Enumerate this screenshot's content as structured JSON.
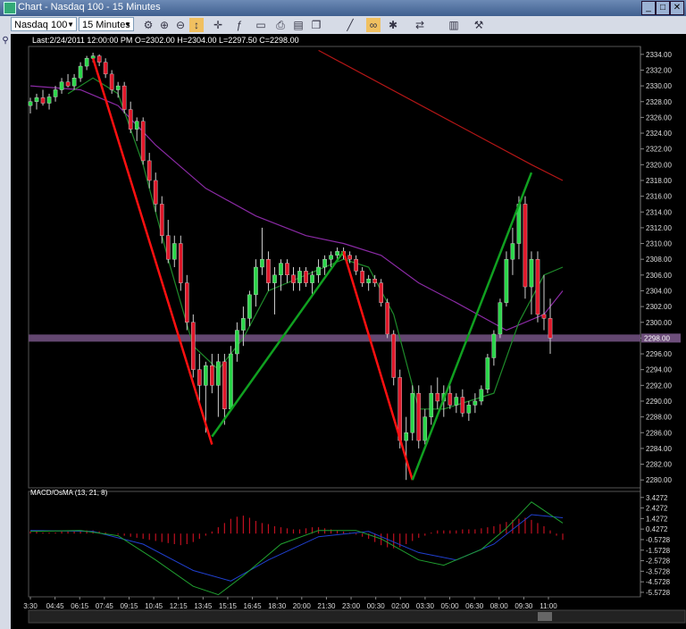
{
  "window": {
    "title": "Chart - Nasdaq 100 - 15 Minutes",
    "minimize": "_",
    "maximize": "□",
    "close": "✕"
  },
  "toolbar": {
    "symbol": "Nasdaq 100",
    "interval": "15 Minutes"
  },
  "icons": [
    "chart-settings-icon",
    "zoom-in-icon",
    "zoom-out-icon",
    "cursor-icon",
    "crosshair-icon",
    "indicator-icon",
    "template-icon",
    "print-icon",
    "save-icon",
    "copy-icon",
    "line-tool-icon",
    "link-icon",
    "object-icon",
    "compare-icon",
    "market-icon",
    "settings-icon"
  ],
  "colors": {
    "bg": "#000000",
    "up": "#2bd64a",
    "down": "#e0182a",
    "grid": "#303030",
    "ma_red": "#b41616",
    "ma_purple": "#8a2aa4",
    "ma_green": "#1e8a2a",
    "price_band": "#6e4f7c"
  },
  "chart_data": [
    {
      "type": "candlestick",
      "header": "Last:2/24/2011 12:00:00 PM O=2302.00 H=2304.00 L=2297.50 C=2298.00",
      "last_price_label": "2298.00",
      "ylim": [
        2279,
        2335
      ],
      "yticks": [
        "2334.00",
        "2332.00",
        "2330.00",
        "2328.00",
        "2326.00",
        "2324.00",
        "2322.00",
        "2320.00",
        "2318.00",
        "2316.00",
        "2314.00",
        "2312.00",
        "2310.00",
        "2308.00",
        "2306.00",
        "2304.00",
        "2302.00",
        "2300.00",
        "2298.00",
        "2296.00",
        "2294.00",
        "2292.00",
        "2290.00",
        "2288.00",
        "2286.00",
        "2284.00",
        "2282.00",
        "2280.00"
      ],
      "xticks": [
        "3:30",
        "04:45",
        "06:15",
        "07:45",
        "09:15",
        "10:45",
        "12:15",
        "13:45",
        "15:15",
        "16:45",
        "18:30",
        "20:00",
        "21:30",
        "23:00",
        "00:30",
        "02:00",
        "03:30",
        "05:00",
        "06:30",
        "08:00",
        "09:30",
        "11:00"
      ],
      "ohlc": [
        [
          2327.5,
          2328.5,
          2326.5,
          2328
        ],
        [
          2328,
          2329,
          2327,
          2328.5
        ],
        [
          2328.5,
          2329.5,
          2327.5,
          2327.8
        ],
        [
          2327.8,
          2329,
          2327,
          2328.6
        ],
        [
          2328.6,
          2330,
          2328,
          2329.5
        ],
        [
          2329.5,
          2331,
          2329,
          2330.5
        ],
        [
          2330.5,
          2331.5,
          2329.8,
          2330
        ],
        [
          2330,
          2331.5,
          2329.5,
          2331
        ],
        [
          2331,
          2333,
          2330.5,
          2332.5
        ],
        [
          2332.5,
          2333.8,
          2332,
          2333.5
        ],
        [
          2333.5,
          2334.2,
          2333,
          2333.8
        ],
        [
          2333.8,
          2334,
          2332.5,
          2333
        ],
        [
          2333,
          2333.5,
          2331,
          2331.5
        ],
        [
          2331.5,
          2332,
          2329,
          2329.5
        ],
        [
          2329.5,
          2330.5,
          2328.5,
          2330
        ],
        [
          2330,
          2330.5,
          2326.5,
          2327
        ],
        [
          2327,
          2328,
          2324,
          2324.5
        ],
        [
          2324.5,
          2326,
          2323,
          2325.5
        ],
        [
          2325.5,
          2326,
          2320,
          2320.5
        ],
        [
          2320.5,
          2321.5,
          2317,
          2318
        ],
        [
          2318,
          2319,
          2314,
          2315
        ],
        [
          2315,
          2316,
          2310,
          2311
        ],
        [
          2311,
          2313,
          2307.5,
          2308
        ],
        [
          2308,
          2311,
          2307,
          2310
        ],
        [
          2310,
          2311,
          2304,
          2305
        ],
        [
          2305,
          2306,
          2299,
          2300
        ],
        [
          2300,
          2301,
          2293,
          2294
        ],
        [
          2294,
          2296,
          2290,
          2292
        ],
        [
          2292,
          2295,
          2286,
          2294.5
        ],
        [
          2294.5,
          2296,
          2291,
          2292
        ],
        [
          2292,
          2296,
          2288,
          2295
        ],
        [
          2295,
          2296,
          2287,
          2289
        ],
        [
          2289,
          2297,
          2289,
          2296
        ],
        [
          2296,
          2300,
          2295,
          2299
        ],
        [
          2299,
          2302,
          2297,
          2300.5
        ],
        [
          2300.5,
          2304,
          2299.5,
          2303.5
        ],
        [
          2303.5,
          2308,
          2302,
          2307
        ],
        [
          2307,
          2312,
          2306,
          2308
        ],
        [
          2308,
          2309,
          2304,
          2305
        ],
        [
          2305,
          2307,
          2301,
          2306
        ],
        [
          2306,
          2308,
          2304,
          2307.5
        ],
        [
          2307.5,
          2308,
          2305,
          2306
        ],
        [
          2306,
          2307,
          2304,
          2305
        ],
        [
          2305,
          2307,
          2304,
          2306.5
        ],
        [
          2306.5,
          2307,
          2304.5,
          2305
        ],
        [
          2305,
          2306.5,
          2303.5,
          2306
        ],
        [
          2306,
          2308,
          2305,
          2307
        ],
        [
          2307,
          2308.5,
          2306,
          2308
        ],
        [
          2308,
          2309,
          2307,
          2308.5
        ],
        [
          2308.5,
          2309.5,
          2308,
          2309
        ],
        [
          2309,
          2309.5,
          2308,
          2308.5
        ],
        [
          2308.5,
          2309,
          2307.5,
          2308
        ],
        [
          2308,
          2308.5,
          2306,
          2306.5
        ],
        [
          2306.5,
          2307,
          2304.5,
          2305
        ],
        [
          2305,
          2306,
          2304,
          2305.5
        ],
        [
          2305.5,
          2306,
          2304.5,
          2305
        ],
        [
          2305,
          2305.5,
          2302,
          2302.5
        ],
        [
          2302.5,
          2303,
          2298,
          2298.5
        ],
        [
          2298.5,
          2299,
          2292,
          2293
        ],
        [
          2293,
          2294,
          2284,
          2285
        ],
        [
          2285,
          2288,
          2280,
          2286
        ],
        [
          2286,
          2292,
          2285,
          2291
        ],
        [
          2291,
          2292,
          2284,
          2285
        ],
        [
          2285,
          2289,
          2284.5,
          2288
        ],
        [
          2288,
          2292,
          2287,
          2291
        ],
        [
          2291,
          2293,
          2289,
          2290
        ],
        [
          2290,
          2292,
          2288,
          2291
        ],
        [
          2291,
          2292,
          2289,
          2289.5
        ],
        [
          2289.5,
          2291,
          2288.5,
          2290.5
        ],
        [
          2290.5,
          2291.5,
          2288,
          2288.5
        ],
        [
          2288.5,
          2290,
          2287.5,
          2289.5
        ],
        [
          2289.5,
          2291,
          2288.5,
          2290
        ],
        [
          2290,
          2292,
          2289.5,
          2291.5
        ],
        [
          2291.5,
          2296,
          2291,
          2295.5
        ],
        [
          2295.5,
          2299,
          2294.5,
          2298.5
        ],
        [
          2298.5,
          2303,
          2298,
          2302.5
        ],
        [
          2302.5,
          2309,
          2302,
          2308
        ],
        [
          2308,
          2312,
          2306,
          2310
        ],
        [
          2310,
          2316,
          2308,
          2315
        ],
        [
          2315,
          2316,
          2303,
          2304.5
        ],
        [
          2304.5,
          2309,
          2301,
          2308
        ],
        [
          2308,
          2309,
          2300,
          2301
        ],
        [
          2301,
          2306,
          2299,
          2300.5
        ],
        [
          2300.5,
          2303,
          2296,
          2298
        ]
      ],
      "moving_averages": [
        {
          "color": "red",
          "values": [
            [
              46,
              2334.5
            ],
            [
              80,
              2320
            ],
            [
              85,
              2318
            ]
          ]
        },
        {
          "color": "purple",
          "values": [
            [
              0,
              2330
            ],
            [
              8,
              2329.5
            ],
            [
              14,
              2327.5
            ],
            [
              20,
              2322.5
            ],
            [
              28,
              2317
            ],
            [
              36,
              2313.5
            ],
            [
              44,
              2311
            ],
            [
              50,
              2310
            ],
            [
              56,
              2308.5
            ],
            [
              62,
              2305
            ],
            [
              68,
              2302.5
            ],
            [
              76,
              2299
            ],
            [
              82,
              2301
            ],
            [
              85,
              2304
            ]
          ]
        },
        {
          "color": "green",
          "values": [
            [
              6,
              2329
            ],
            [
              10,
              2331
            ],
            [
              14,
              2329
            ],
            [
              18,
              2320
            ],
            [
              22,
              2308
            ],
            [
              26,
              2297
            ],
            [
              30,
              2294
            ],
            [
              34,
              2298
            ],
            [
              38,
              2304
            ],
            [
              44,
              2306
            ],
            [
              50,
              2308
            ],
            [
              54,
              2307
            ],
            [
              58,
              2301
            ],
            [
              62,
              2289
            ],
            [
              66,
              2289
            ],
            [
              70,
              2290
            ],
            [
              74,
              2291
            ],
            [
              78,
              2300
            ],
            [
              82,
              2306
            ],
            [
              85,
              2307
            ]
          ]
        }
      ],
      "trend_lines": [
        {
          "color": "red",
          "from": [
            10,
            2333.5
          ],
          "to": [
            29,
            2284.5
          ]
        },
        {
          "color": "green",
          "from": [
            29,
            2285.5
          ],
          "to": [
            50,
            2309
          ]
        },
        {
          "color": "red",
          "from": [
            50,
            2309
          ],
          "to": [
            61,
            2280
          ]
        },
        {
          "color": "green",
          "from": [
            61,
            2280
          ],
          "to": [
            80,
            2319
          ]
        }
      ]
    },
    {
      "type": "macd",
      "label": "MACD/OsMA (13, 21, 8)",
      "ylim": [
        -6,
        4
      ],
      "yticks": [
        "3.4272",
        "2.4272",
        "1.4272",
        "0.4272",
        "-0.5728",
        "-1.5728",
        "-2.5728",
        "-3.5728",
        "-4.5728",
        "-5.5728"
      ],
      "histogram": [
        0.2,
        0.2,
        0.1,
        0.1,
        0.1,
        0.2,
        0.2,
        0.2,
        0.3,
        0.3,
        0.3,
        0.2,
        0.1,
        0.0,
        -0.1,
        -0.2,
        -0.3,
        -0.4,
        -0.5,
        -0.6,
        -0.7,
        -0.8,
        -0.9,
        -1.0,
        -1.1,
        -1.0,
        -0.8,
        -0.5,
        -0.2,
        0.2,
        0.6,
        1.0,
        1.4,
        1.6,
        1.7,
        1.5,
        1.2,
        1.0,
        0.9,
        0.7,
        0.6,
        0.5,
        0.4,
        0.4,
        0.5,
        0.6,
        0.6,
        0.5,
        0.4,
        0.3,
        0.2,
        0.1,
        -0.1,
        -0.3,
        -0.5,
        -0.8,
        -1.1,
        -1.3,
        -1.4,
        -1.3,
        -1.0,
        -0.7,
        -0.4,
        -0.2,
        0.1,
        0.3,
        0.3,
        0.3,
        0.3,
        0.4,
        0.4,
        0.4,
        0.5,
        0.6,
        0.7,
        0.9,
        1.1,
        1.3,
        1.4,
        1.5,
        1.3,
        1.0,
        0.7,
        0.3,
        -0.2,
        -0.6
      ],
      "macd_line": [
        [
          0,
          0.2
        ],
        [
          8,
          0.3
        ],
        [
          14,
          -0.2
        ],
        [
          20,
          -2.5
        ],
        [
          26,
          -5.0
        ],
        [
          30,
          -5.8
        ],
        [
          34,
          -4.0
        ],
        [
          40,
          -1.0
        ],
        [
          46,
          0.3
        ],
        [
          52,
          0.3
        ],
        [
          56,
          -0.5
        ],
        [
          62,
          -2.5
        ],
        [
          66,
          -3.0
        ],
        [
          72,
          -1.5
        ],
        [
          76,
          0.5
        ],
        [
          80,
          3.0
        ],
        [
          85,
          1.0
        ]
      ],
      "signal_line": [
        [
          0,
          0.3
        ],
        [
          10,
          0.2
        ],
        [
          18,
          -1.0
        ],
        [
          26,
          -3.5
        ],
        [
          32,
          -4.5
        ],
        [
          38,
          -2.5
        ],
        [
          46,
          -0.3
        ],
        [
          54,
          0.2
        ],
        [
          62,
          -1.8
        ],
        [
          68,
          -2.5
        ],
        [
          74,
          -1.0
        ],
        [
          80,
          1.8
        ],
        [
          85,
          1.5
        ]
      ]
    }
  ]
}
